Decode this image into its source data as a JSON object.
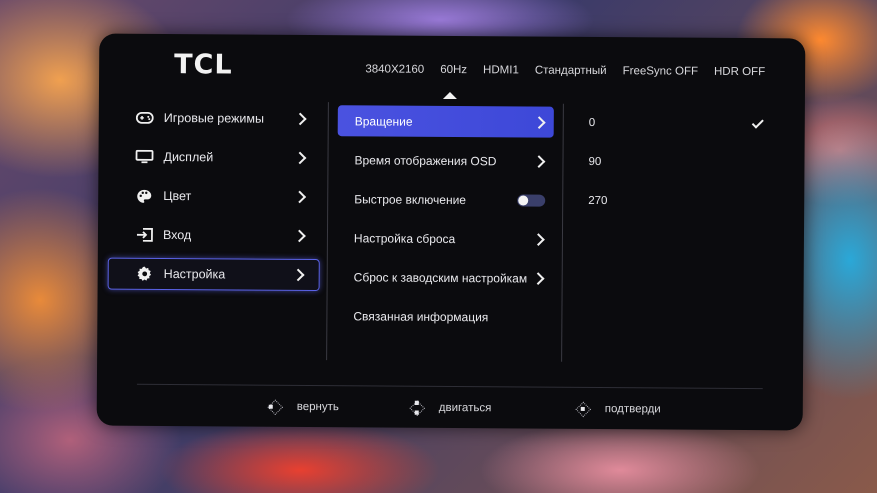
{
  "header": {
    "logo": "TCL",
    "status": [
      "3840X2160",
      "60Hz",
      "HDMI1",
      "Стандартный",
      "FreeSync OFF",
      "HDR OFF"
    ]
  },
  "categories": [
    {
      "label": "Игровые режимы",
      "icon": "gamepad-icon"
    },
    {
      "label": "Дисплей",
      "icon": "monitor-icon"
    },
    {
      "label": "Цвет",
      "icon": "palette-icon"
    },
    {
      "label": "Вход",
      "icon": "input-icon"
    },
    {
      "label": "Настройка",
      "icon": "gear-icon",
      "selected": true
    }
  ],
  "submenu": [
    {
      "label": "Вращение",
      "control": "chevron",
      "selected": true
    },
    {
      "label": "Время отображения OSD",
      "control": "chevron"
    },
    {
      "label": "Быстрое включение",
      "control": "toggle",
      "toggle_on": false
    },
    {
      "label": "Настройка сброса",
      "control": "chevron"
    },
    {
      "label": "Сброс к заводским настройкам",
      "control": "chevron"
    },
    {
      "label": "Связанная информация",
      "control": "none"
    }
  ],
  "options": [
    {
      "label": "0",
      "checked": true
    },
    {
      "label": "90",
      "checked": false
    },
    {
      "label": "270",
      "checked": false
    }
  ],
  "footer": {
    "back": "вернуть",
    "move": "двигаться",
    "confirm": "подтверди"
  },
  "colors": {
    "accent": "#4a52e0",
    "osd_background": "#0b0b0e"
  }
}
